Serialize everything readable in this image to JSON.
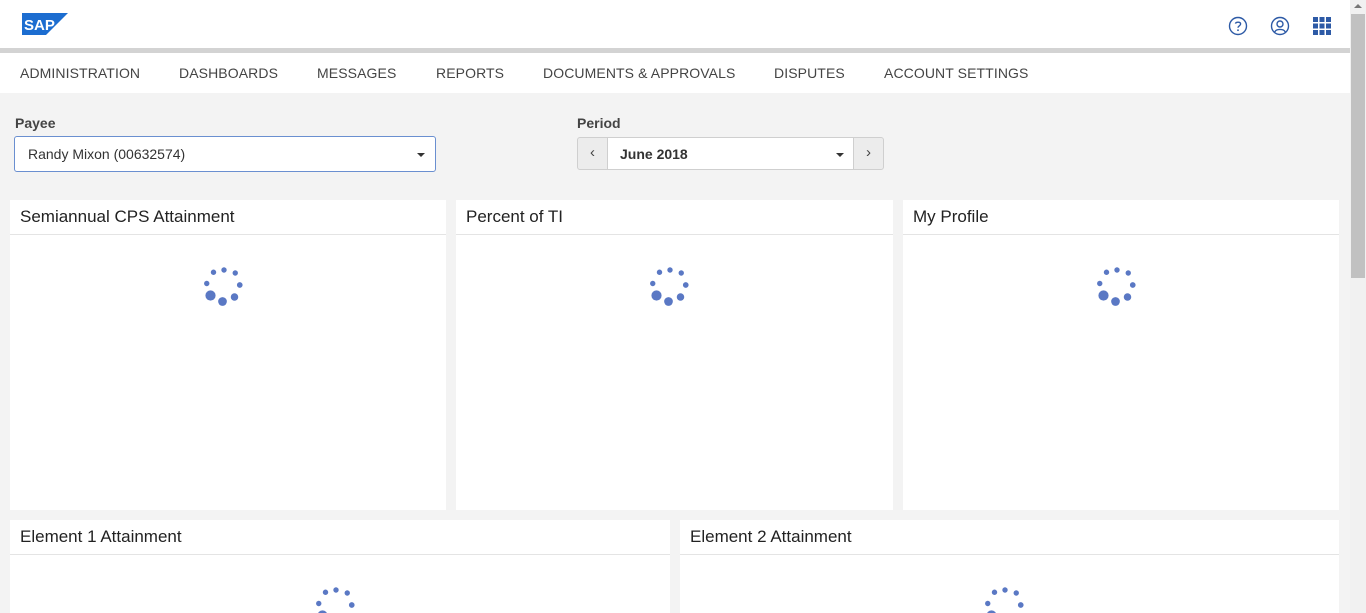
{
  "header": {
    "logo_text": "SAP",
    "brand_color": "#1c6dd0",
    "icons": [
      "help-icon",
      "user-icon",
      "app-grid-icon"
    ]
  },
  "nav": {
    "items": [
      {
        "label": "ADMINISTRATION"
      },
      {
        "label": "DASHBOARDS"
      },
      {
        "label": "MESSAGES"
      },
      {
        "label": "REPORTS"
      },
      {
        "label": "DOCUMENTS & APPROVALS"
      },
      {
        "label": "DISPUTES"
      },
      {
        "label": "ACCOUNT SETTINGS"
      }
    ]
  },
  "filters": {
    "payee": {
      "label": "Payee",
      "value": "Randy Mixon (00632574)"
    },
    "period": {
      "label": "Period",
      "value": "June 2018",
      "prev": "‹",
      "next": "›"
    }
  },
  "cards": [
    {
      "title": "Semiannual CPS Attainment"
    },
    {
      "title": "Percent of TI"
    },
    {
      "title": "My Profile"
    },
    {
      "title": "Element 1 Attainment"
    },
    {
      "title": "Element 2 Attainment"
    }
  ],
  "spinner_color": "#5a78c4"
}
